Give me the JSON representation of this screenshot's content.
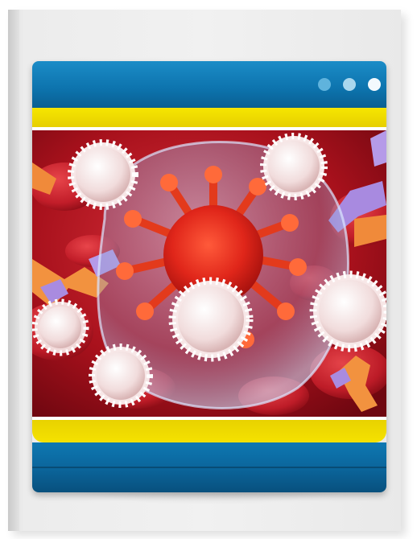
{
  "window": {
    "controls": [
      {
        "name": "window-dot-1",
        "color": "#5fb3dd"
      },
      {
        "name": "window-dot-2",
        "color": "#a9d7ee"
      },
      {
        "name": "window-dot-3",
        "color": "#f3f9fd"
      }
    ]
  },
  "illustration": {
    "subject": "virus-in-bloodstream-icon"
  },
  "colors": {
    "titlebar": "#0d73ad",
    "accent_yellow": "#f2dd00",
    "footer": "#0b649a",
    "background_red": "#b3141e"
  }
}
